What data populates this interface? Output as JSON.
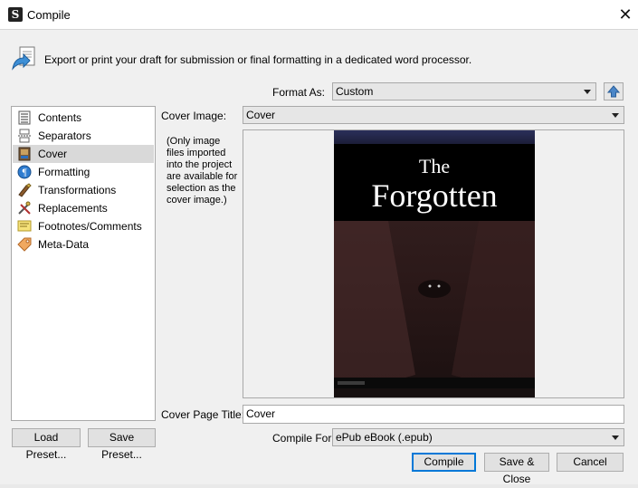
{
  "window": {
    "title": "Compile"
  },
  "header": {
    "description": "Export or print your draft for submission or final formatting in a dedicated word processor."
  },
  "format": {
    "label": "Format As:",
    "value": "Custom"
  },
  "sidebar": {
    "items": [
      {
        "label": "Contents",
        "icon": "list-icon"
      },
      {
        "label": "Separators",
        "icon": "separator-icon"
      },
      {
        "label": "Cover",
        "icon": "cover-icon"
      },
      {
        "label": "Formatting",
        "icon": "formatting-icon"
      },
      {
        "label": "Transformations",
        "icon": "transformations-icon"
      },
      {
        "label": "Replacements",
        "icon": "replacements-icon"
      },
      {
        "label": "Footnotes/Comments",
        "icon": "footnotes-icon"
      },
      {
        "label": "Meta-Data",
        "icon": "tag-icon"
      }
    ],
    "selected_index": 2
  },
  "cover": {
    "image_label": "Cover Image:",
    "image_value": "Cover",
    "hint": "(Only image files imported into the project are available for selection as the cover image.)",
    "art_title_line1": "The",
    "art_title_line2": "Forgotten",
    "page_title_label": "Cover Page Title:",
    "page_title_value": "Cover"
  },
  "compile_for": {
    "label": "Compile For:",
    "value": "ePub eBook (.epub)"
  },
  "buttons": {
    "load_preset": "Load Preset...",
    "save_preset": "Save Preset...",
    "compile": "Compile",
    "save_close": "Save & Close",
    "cancel": "Cancel"
  },
  "colors": {
    "accent": "#0078d7",
    "selected_row": "#d9d9d9"
  }
}
